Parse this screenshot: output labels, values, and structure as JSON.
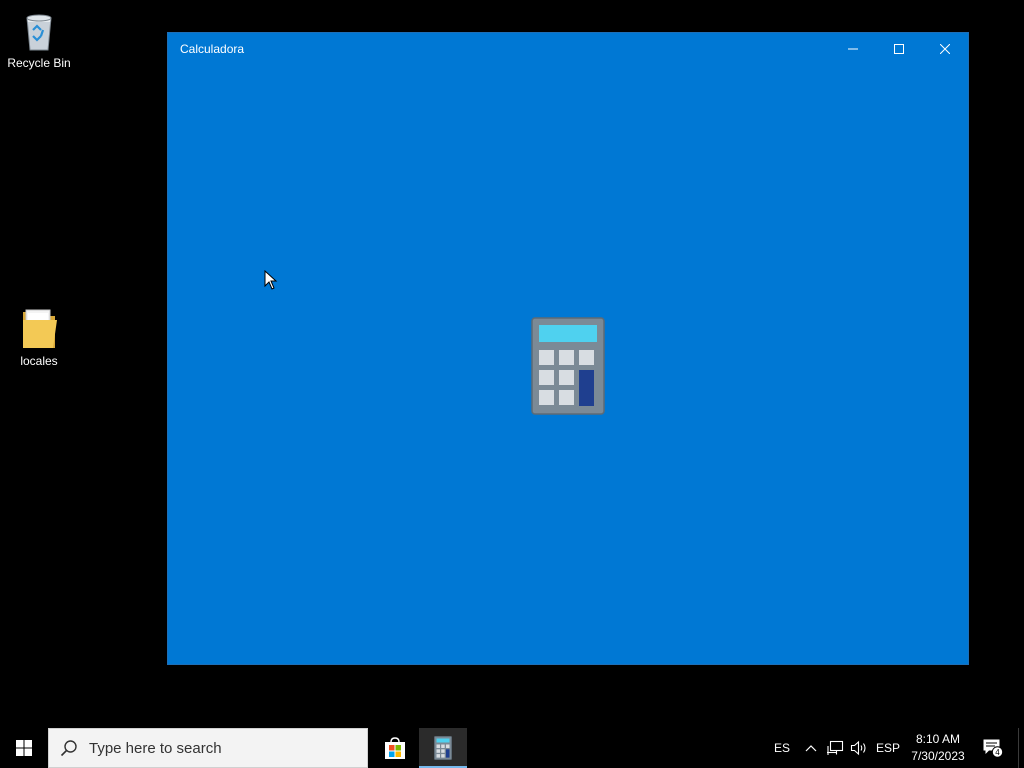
{
  "desktop": {
    "icons": [
      {
        "label": "Recycle Bin",
        "icon": "recycle-bin-icon"
      },
      {
        "label": "locales",
        "icon": "folder-icon"
      }
    ]
  },
  "window": {
    "title": "Calculadora",
    "splash_icon": "calculator-icon",
    "accent": "#0078d4",
    "controls": {
      "minimize": "minimize-icon",
      "maximize": "maximize-icon",
      "close": "close-icon"
    }
  },
  "taskbar": {
    "search_placeholder": "Type here to search",
    "apps": [
      {
        "icon": "microsoft-store-icon"
      },
      {
        "icon": "calculator-icon",
        "active": true
      }
    ],
    "tray": {
      "input_language": "ES",
      "keyboard_layout": "ESP",
      "time": "8:10 AM",
      "date": "7/30/2023",
      "notification_count": "4"
    }
  }
}
